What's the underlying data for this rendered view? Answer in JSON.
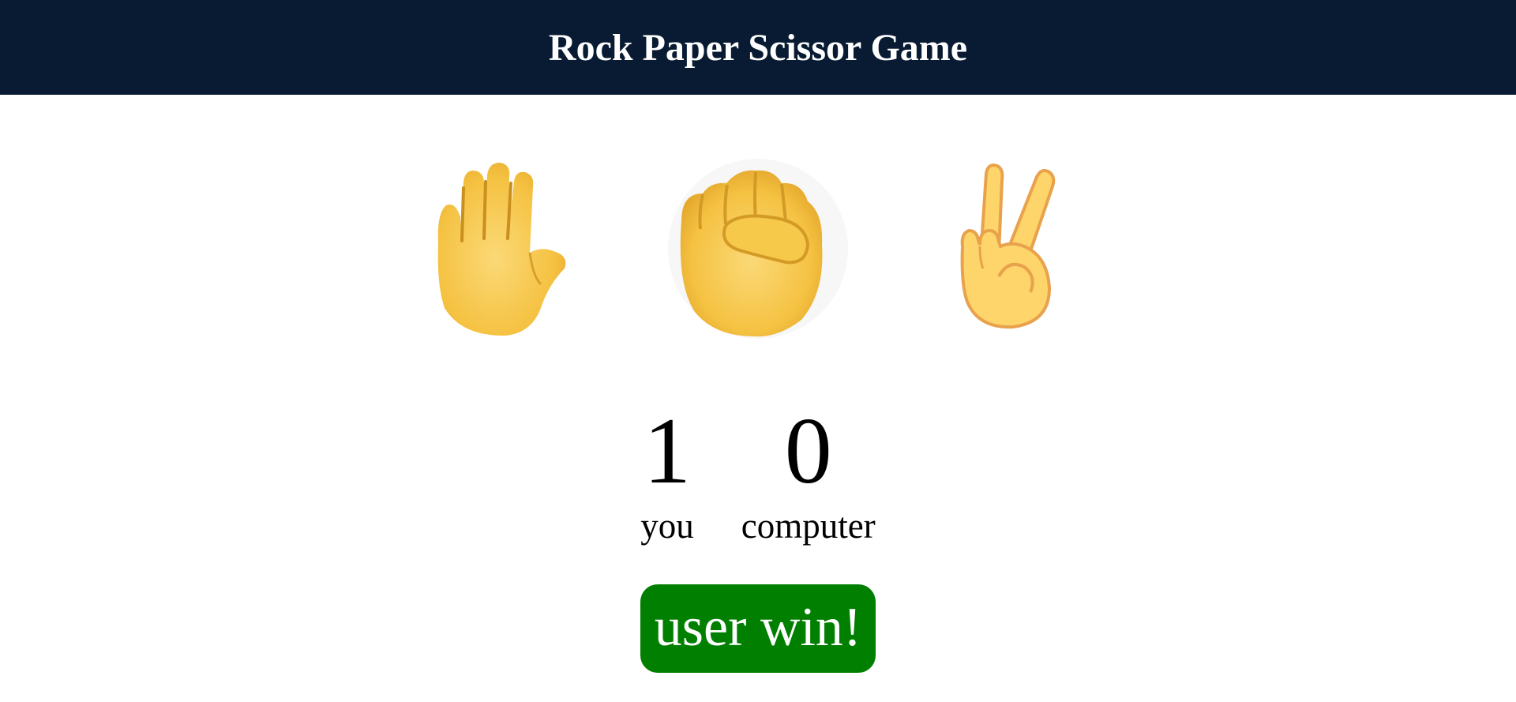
{
  "header": {
    "title": "Rock Paper Scissor Game"
  },
  "choices": [
    {
      "name": "paper",
      "icon": "raised-hand-icon"
    },
    {
      "name": "rock",
      "icon": "raised-fist-icon"
    },
    {
      "name": "scissors",
      "icon": "victory-hand-icon"
    }
  ],
  "scoreboard": {
    "user_score": "1",
    "user_label": "you",
    "computer_score": "0",
    "computer_label": "computer"
  },
  "message": {
    "text": "user win!",
    "color": "#007f00"
  },
  "colors": {
    "header_bg": "#081b33",
    "emoji_yellow": "#f7c94b"
  }
}
